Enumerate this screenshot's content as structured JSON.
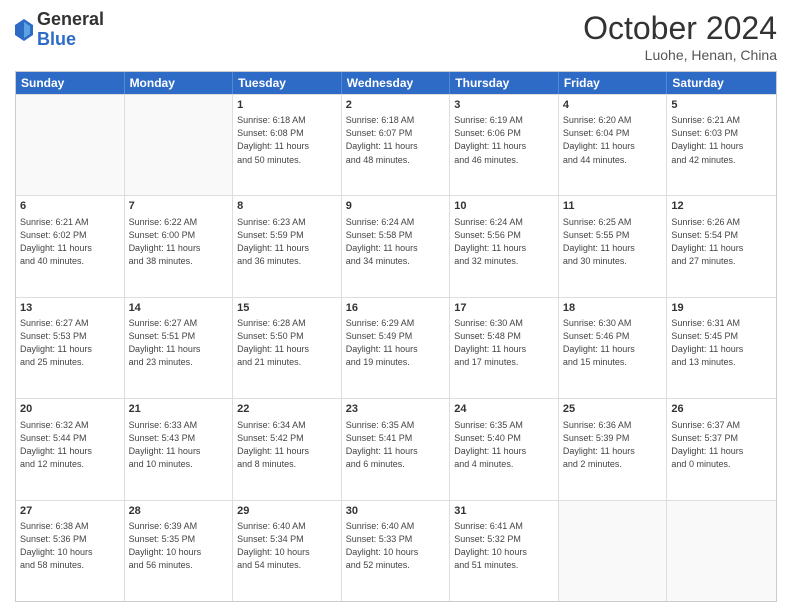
{
  "header": {
    "logo": {
      "general": "General",
      "blue": "Blue"
    },
    "title": "October 2024",
    "location": "Luohe, Henan, China"
  },
  "days": [
    "Sunday",
    "Monday",
    "Tuesday",
    "Wednesday",
    "Thursday",
    "Friday",
    "Saturday"
  ],
  "rows": [
    [
      {
        "day": "",
        "info": ""
      },
      {
        "day": "",
        "info": ""
      },
      {
        "day": "1",
        "info": "Sunrise: 6:18 AM\nSunset: 6:08 PM\nDaylight: 11 hours\nand 50 minutes."
      },
      {
        "day": "2",
        "info": "Sunrise: 6:18 AM\nSunset: 6:07 PM\nDaylight: 11 hours\nand 48 minutes."
      },
      {
        "day": "3",
        "info": "Sunrise: 6:19 AM\nSunset: 6:06 PM\nDaylight: 11 hours\nand 46 minutes."
      },
      {
        "day": "4",
        "info": "Sunrise: 6:20 AM\nSunset: 6:04 PM\nDaylight: 11 hours\nand 44 minutes."
      },
      {
        "day": "5",
        "info": "Sunrise: 6:21 AM\nSunset: 6:03 PM\nDaylight: 11 hours\nand 42 minutes."
      }
    ],
    [
      {
        "day": "6",
        "info": "Sunrise: 6:21 AM\nSunset: 6:02 PM\nDaylight: 11 hours\nand 40 minutes."
      },
      {
        "day": "7",
        "info": "Sunrise: 6:22 AM\nSunset: 6:00 PM\nDaylight: 11 hours\nand 38 minutes."
      },
      {
        "day": "8",
        "info": "Sunrise: 6:23 AM\nSunset: 5:59 PM\nDaylight: 11 hours\nand 36 minutes."
      },
      {
        "day": "9",
        "info": "Sunrise: 6:24 AM\nSunset: 5:58 PM\nDaylight: 11 hours\nand 34 minutes."
      },
      {
        "day": "10",
        "info": "Sunrise: 6:24 AM\nSunset: 5:56 PM\nDaylight: 11 hours\nand 32 minutes."
      },
      {
        "day": "11",
        "info": "Sunrise: 6:25 AM\nSunset: 5:55 PM\nDaylight: 11 hours\nand 30 minutes."
      },
      {
        "day": "12",
        "info": "Sunrise: 6:26 AM\nSunset: 5:54 PM\nDaylight: 11 hours\nand 27 minutes."
      }
    ],
    [
      {
        "day": "13",
        "info": "Sunrise: 6:27 AM\nSunset: 5:53 PM\nDaylight: 11 hours\nand 25 minutes."
      },
      {
        "day": "14",
        "info": "Sunrise: 6:27 AM\nSunset: 5:51 PM\nDaylight: 11 hours\nand 23 minutes."
      },
      {
        "day": "15",
        "info": "Sunrise: 6:28 AM\nSunset: 5:50 PM\nDaylight: 11 hours\nand 21 minutes."
      },
      {
        "day": "16",
        "info": "Sunrise: 6:29 AM\nSunset: 5:49 PM\nDaylight: 11 hours\nand 19 minutes."
      },
      {
        "day": "17",
        "info": "Sunrise: 6:30 AM\nSunset: 5:48 PM\nDaylight: 11 hours\nand 17 minutes."
      },
      {
        "day": "18",
        "info": "Sunrise: 6:30 AM\nSunset: 5:46 PM\nDaylight: 11 hours\nand 15 minutes."
      },
      {
        "day": "19",
        "info": "Sunrise: 6:31 AM\nSunset: 5:45 PM\nDaylight: 11 hours\nand 13 minutes."
      }
    ],
    [
      {
        "day": "20",
        "info": "Sunrise: 6:32 AM\nSunset: 5:44 PM\nDaylight: 11 hours\nand 12 minutes."
      },
      {
        "day": "21",
        "info": "Sunrise: 6:33 AM\nSunset: 5:43 PM\nDaylight: 11 hours\nand 10 minutes."
      },
      {
        "day": "22",
        "info": "Sunrise: 6:34 AM\nSunset: 5:42 PM\nDaylight: 11 hours\nand 8 minutes."
      },
      {
        "day": "23",
        "info": "Sunrise: 6:35 AM\nSunset: 5:41 PM\nDaylight: 11 hours\nand 6 minutes."
      },
      {
        "day": "24",
        "info": "Sunrise: 6:35 AM\nSunset: 5:40 PM\nDaylight: 11 hours\nand 4 minutes."
      },
      {
        "day": "25",
        "info": "Sunrise: 6:36 AM\nSunset: 5:39 PM\nDaylight: 11 hours\nand 2 minutes."
      },
      {
        "day": "26",
        "info": "Sunrise: 6:37 AM\nSunset: 5:37 PM\nDaylight: 11 hours\nand 0 minutes."
      }
    ],
    [
      {
        "day": "27",
        "info": "Sunrise: 6:38 AM\nSunset: 5:36 PM\nDaylight: 10 hours\nand 58 minutes."
      },
      {
        "day": "28",
        "info": "Sunrise: 6:39 AM\nSunset: 5:35 PM\nDaylight: 10 hours\nand 56 minutes."
      },
      {
        "day": "29",
        "info": "Sunrise: 6:40 AM\nSunset: 5:34 PM\nDaylight: 10 hours\nand 54 minutes."
      },
      {
        "day": "30",
        "info": "Sunrise: 6:40 AM\nSunset: 5:33 PM\nDaylight: 10 hours\nand 52 minutes."
      },
      {
        "day": "31",
        "info": "Sunrise: 6:41 AM\nSunset: 5:32 PM\nDaylight: 10 hours\nand 51 minutes."
      },
      {
        "day": "",
        "info": ""
      },
      {
        "day": "",
        "info": ""
      }
    ]
  ]
}
